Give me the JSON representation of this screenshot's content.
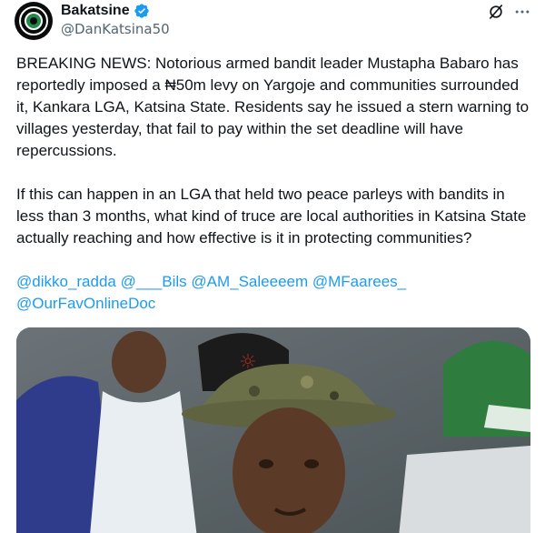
{
  "author": {
    "display_name": "Bakatsine",
    "handle": "@DanKatsina50",
    "verified": true
  },
  "icons": {
    "avatar": "bakatsine-logo",
    "verified": "verified-badge-icon",
    "grok": "grok-icon",
    "more": "more-icon"
  },
  "tweet": {
    "paragraph_1": "BREAKING NEWS: Notorious armed bandit leader Mustapha Babaro has reportedly imposed a ₦50m levy on Yargoje and communities surrounded it, Kankara LGA, Katsina State. Residents say he issued a stern warning to villages yesterday, that fail to pay within the set deadline will have repercussions.",
    "paragraph_2": "If this can happen in an LGA that held two peace parleys with bandits in less than 3 months, what kind of truce are local authorities in Katsina State actually reaching and how effective is it in protecting communities?",
    "mentions": [
      "@dikko_radda",
      "@___Bils",
      "@AM_Saleeeem",
      "@MFaarees_",
      "@OurFavOnlineDoc"
    ]
  },
  "colors": {
    "text": "#0f1419",
    "secondary": "#536471",
    "link": "#1d9bf0",
    "verified": "#1d9bf0"
  }
}
